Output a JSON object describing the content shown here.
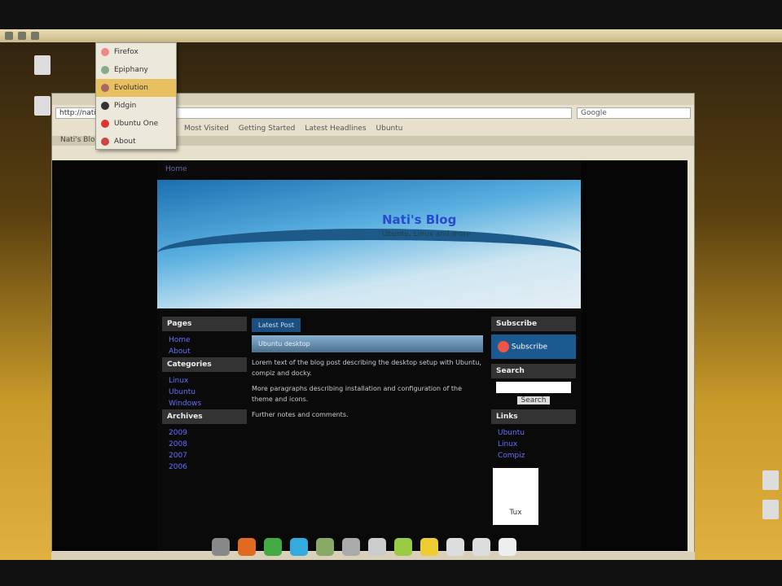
{
  "menu": {
    "items": [
      "Firefox",
      "Epiphany",
      "Evolution",
      "Pidgin",
      "Ubuntu One",
      "About"
    ]
  },
  "browser": {
    "url": "http://nati.blogspot.com/",
    "search_placeholder": "Google",
    "bookmarks": [
      "Most Visited",
      "Getting Started",
      "Latest Headlines",
      "Ubuntu"
    ],
    "tab": "Nati's Blog"
  },
  "blog": {
    "title": "Nati's Blog",
    "subtitle": "Ubuntu, Linux and more",
    "nav_label": "Home",
    "left_sidebar": [
      {
        "heading": "Pages",
        "links": [
          "Home",
          "About"
        ]
      },
      {
        "heading": "Categories",
        "links": [
          "Linux",
          "Ubuntu",
          "Windows"
        ]
      },
      {
        "heading": "Archives",
        "links": [
          "2009",
          "2008",
          "2007",
          "2006"
        ]
      }
    ],
    "post_tab": "Latest Post",
    "post_title": "Ubuntu desktop",
    "post_body": [
      "Lorem text of the blog post describing the desktop setup with Ubuntu, compiz and docky.",
      "More paragraphs describing installation and configuration of the theme and icons.",
      "Further notes and comments."
    ],
    "right_sidebar": {
      "heading1": "Subscribe",
      "subscribe_btn": "Subscribe",
      "heading2": "Search",
      "search_btn": "Search",
      "heading3": "Links",
      "links": [
        "Ubuntu",
        "Linux",
        "Compiz"
      ],
      "badge": "Tux"
    }
  },
  "colors": {
    "accent": "#1b4f80",
    "link": "#6670ff"
  }
}
